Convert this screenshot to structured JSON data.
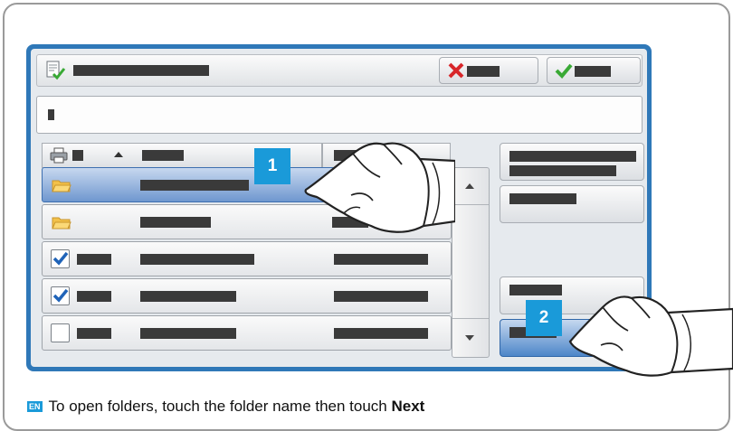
{
  "steps": {
    "step1": "1",
    "step2": "2"
  },
  "caption": {
    "lang_badge": "EN",
    "text": "To open folders, touch the folder name then touch ",
    "bold": "Next"
  },
  "colors": {
    "accent_blue": "#1a9ad9",
    "panel_border": "#2f78b8",
    "selected_row": "#6f97cf"
  },
  "icons": [
    "document-check-icon",
    "cancel-x-icon",
    "confirm-check-icon",
    "printer-icon",
    "sort-up-icon",
    "folder-icon",
    "checkbox-icon",
    "scroll-up-icon",
    "scroll-down-icon"
  ],
  "rows": [
    {
      "type": "folder",
      "selected": true,
      "checked": false
    },
    {
      "type": "folder",
      "selected": false,
      "checked": false
    },
    {
      "type": "file",
      "selected": false,
      "checked": true
    },
    {
      "type": "file",
      "selected": false,
      "checked": true
    },
    {
      "type": "file",
      "selected": false,
      "checked": false
    }
  ]
}
